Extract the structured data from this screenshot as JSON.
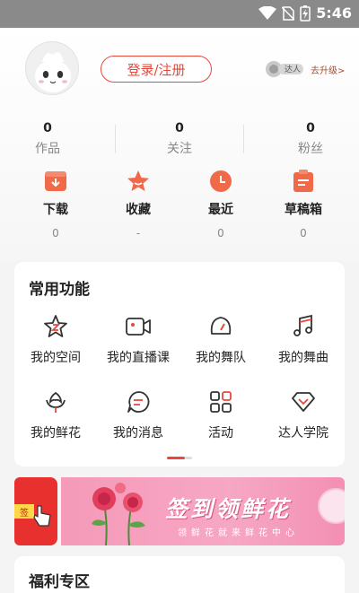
{
  "status_bar": {
    "time": "5:46",
    "icons": [
      "wifi-icon",
      "no-sim-icon",
      "battery-charging-icon"
    ]
  },
  "profile": {
    "login_label": "登录/注册",
    "level_badge": "达人",
    "upgrade_label": "去升级>"
  },
  "stats": [
    {
      "value": "0",
      "label": "作品"
    },
    {
      "value": "0",
      "label": "关注"
    },
    {
      "value": "0",
      "label": "粉丝"
    }
  ],
  "quick_actions": [
    {
      "label": "下载",
      "count": "0",
      "icon": "download-icon"
    },
    {
      "label": "收藏",
      "count": "-",
      "icon": "star-icon"
    },
    {
      "label": "最近",
      "count": "0",
      "icon": "clock-icon"
    },
    {
      "label": "草稿箱",
      "count": "0",
      "icon": "drafts-icon"
    }
  ],
  "common_functions": {
    "title": "常用功能",
    "items": [
      {
        "label": "我的空间",
        "icon": "space-star-icon"
      },
      {
        "label": "我的直播课",
        "icon": "video-camera-icon"
      },
      {
        "label": "我的舞队",
        "icon": "gauge-icon"
      },
      {
        "label": "我的舞曲",
        "icon": "music-note-icon"
      },
      {
        "label": "我的鲜花",
        "icon": "flower-icon"
      },
      {
        "label": "我的消息",
        "icon": "message-icon"
      },
      {
        "label": "活动",
        "icon": "grid-icon"
      },
      {
        "label": "达人学院",
        "icon": "heart-badge-icon"
      }
    ]
  },
  "banner": {
    "side_tag": "签",
    "title": "签到领鲜花",
    "subtitle": "领鲜花就来鲜花中心"
  },
  "welfare": {
    "title": "福利专区"
  },
  "colors": {
    "accent": "#e8483c",
    "banner_pink": "#f6a7c4"
  }
}
